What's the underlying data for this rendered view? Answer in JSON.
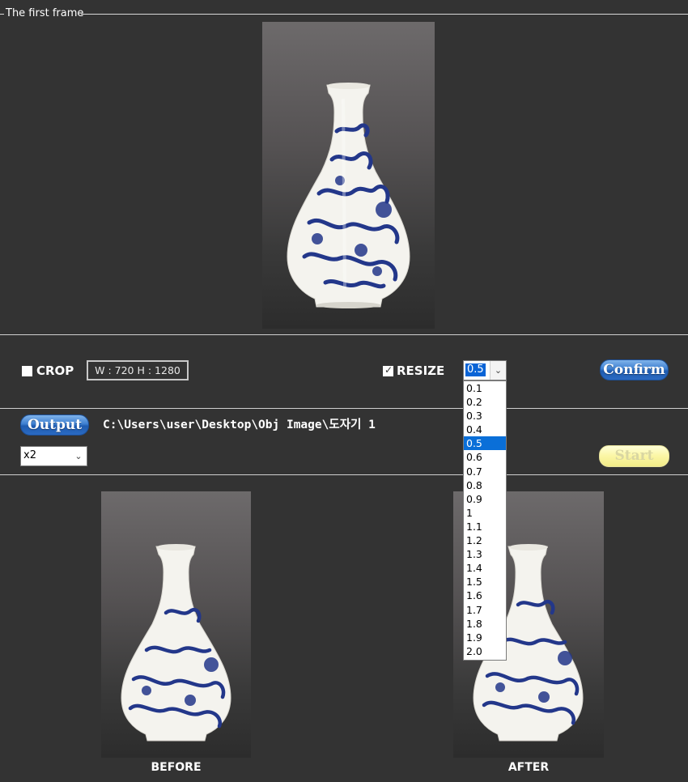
{
  "frame": {
    "legend": "The first frame"
  },
  "crop": {
    "label": "CROP",
    "checked": false,
    "dimensions": "W : 720  H : 1280"
  },
  "resize": {
    "label": "RESIZE",
    "checked": true,
    "selected": "0.5",
    "options": [
      "0.1",
      "0.2",
      "0.3",
      "0.4",
      "0.5",
      "0.6",
      "0.7",
      "0.8",
      "0.9",
      "1",
      "1.1",
      "1.2",
      "1.3",
      "1.4",
      "1.5",
      "1.6",
      "1.7",
      "1.8",
      "1.9",
      "2.0"
    ]
  },
  "confirm_button": "Confirm",
  "output": {
    "button": "Output",
    "path": "C:\\Users\\user\\Desktop\\Obj Image\\도자기 1"
  },
  "scale": {
    "selected": "x2"
  },
  "start_button": "Start",
  "captions": {
    "before": "BEFORE",
    "after": "AFTER"
  },
  "colors": {
    "background": "#333333",
    "button_blue": "#2a6ac2",
    "button_yellow": "#fbf6a4",
    "selection_blue": "#0a6fd8",
    "porcelain_blue": "#23378a"
  },
  "icons": {
    "dropdown": "chevron-down-icon",
    "checkbox_checked": "checkmark-icon"
  }
}
